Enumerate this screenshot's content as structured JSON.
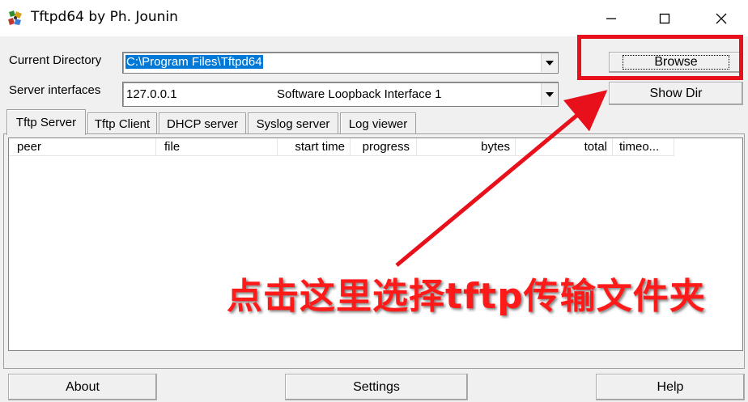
{
  "window": {
    "title": "Tftpd64 by Ph. Jounin"
  },
  "form": {
    "current_directory_label": "Current Directory",
    "current_directory_value": "C:\\Program Files\\Tftpd64",
    "server_interfaces_label": "Server interfaces",
    "server_ip": "127.0.0.1",
    "server_interface_name": "Software Loopback Interface 1",
    "browse_label": "Browse",
    "show_dir_label": "Show Dir"
  },
  "tabs": [
    {
      "label": "Tftp Server",
      "active": true
    },
    {
      "label": "Tftp Client",
      "active": false
    },
    {
      "label": "DHCP server",
      "active": false
    },
    {
      "label": "Syslog server",
      "active": false
    },
    {
      "label": "Log viewer",
      "active": false
    }
  ],
  "table": {
    "columns": [
      "peer",
      "file",
      "start time",
      "progress",
      "bytes",
      "total",
      "timeo..."
    ],
    "rows": []
  },
  "footer": {
    "about_label": "About",
    "settings_label": "Settings",
    "help_label": "Help"
  },
  "annotation": {
    "text": "点击这里选择tftp传输文件夹",
    "color": "#ff1a1a"
  },
  "colors": {
    "selection": "#0078d7",
    "highlight_border": "#e8101a"
  }
}
